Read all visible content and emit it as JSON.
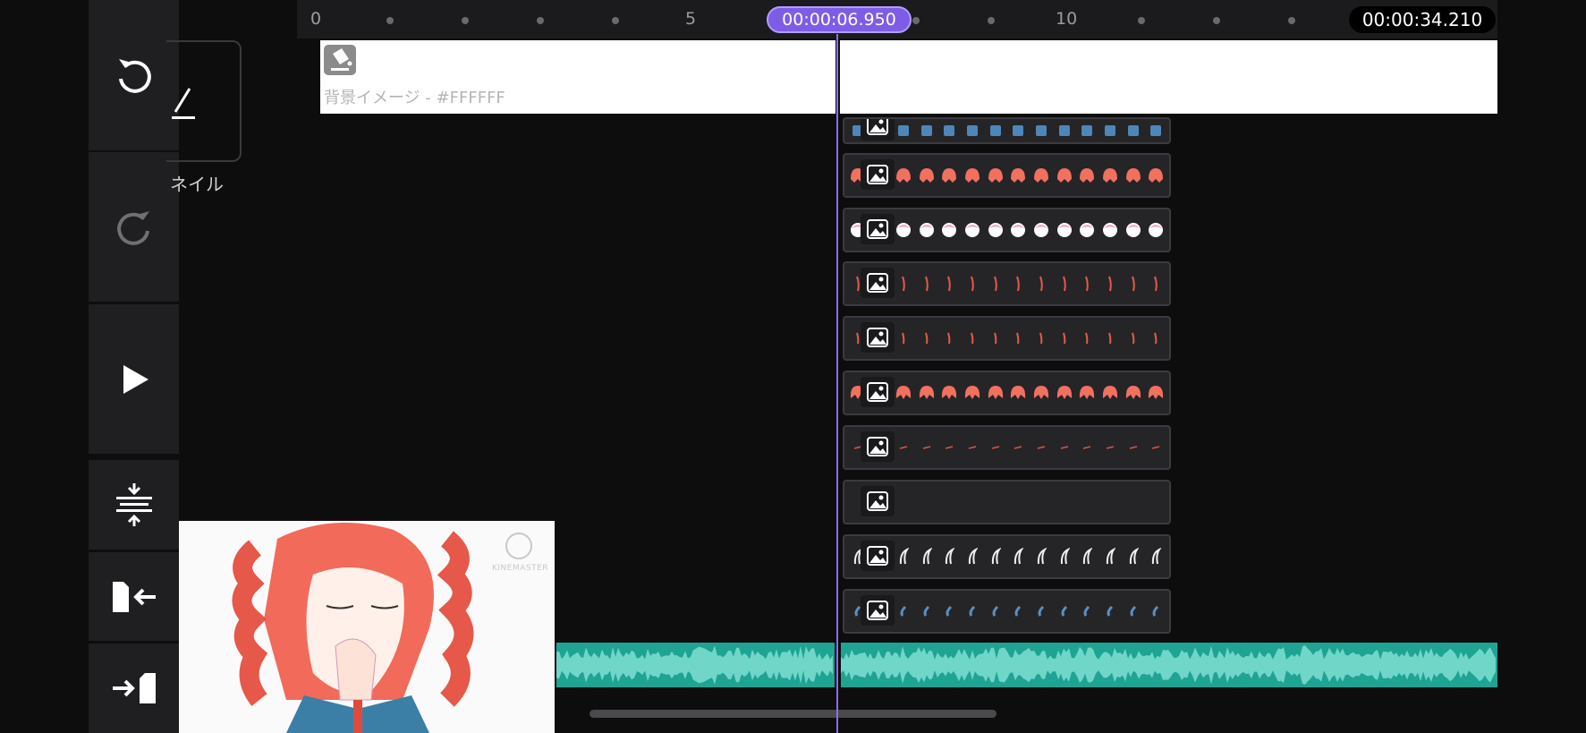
{
  "timeline": {
    "current_time": "00:00:06.950",
    "total_duration": "00:00:34.210",
    "ruler_numbers": [
      "0",
      "5",
      "10"
    ]
  },
  "background_track": {
    "label": "背景イメージ - #FFFFFF",
    "color": "#FFFFFF"
  },
  "media_browser": {
    "label": "ネイル"
  },
  "tools": [
    {
      "name": "undo",
      "icon": "undo-icon",
      "enabled": true
    },
    {
      "name": "redo",
      "icon": "redo-icon",
      "enabled": false
    },
    {
      "name": "play",
      "icon": "play-icon"
    },
    {
      "name": "fit-timeline",
      "icon": "compress-vertical-icon"
    },
    {
      "name": "jump-to-start",
      "icon": "jump-start-icon"
    },
    {
      "name": "jump-to-end",
      "icon": "jump-end-icon"
    }
  ],
  "layers": [
    {
      "type": "image",
      "icon": "image-icon",
      "thumb_color": "#4e86b8"
    },
    {
      "type": "image",
      "icon": "image-icon",
      "thumb_color": "#f2705f"
    },
    {
      "type": "image",
      "icon": "image-icon",
      "thumb_color": "#f3a6c6"
    },
    {
      "type": "image",
      "icon": "image-icon",
      "thumb_color": "#e8584a"
    },
    {
      "type": "image",
      "icon": "image-icon",
      "thumb_color": "#e8584a"
    },
    {
      "type": "image",
      "icon": "image-icon",
      "thumb_color": "#f2705f"
    },
    {
      "type": "image",
      "icon": "image-icon",
      "thumb_color": "#d9544a"
    },
    {
      "type": "image",
      "icon": "image-icon",
      "thumb_color": "#2a2a2d"
    },
    {
      "type": "image",
      "icon": "image-icon",
      "thumb_color": "#f0f0f0"
    },
    {
      "type": "image",
      "icon": "image-icon",
      "thumb_color": "#5b8fc0"
    }
  ],
  "audio_track": {
    "color": "#1fa393",
    "wave_color": "#6fd6c8"
  },
  "preview": {
    "watermark": "KINEMASTER",
    "accent_color": "#f0604f"
  },
  "colors": {
    "accent": "#7f5ce6",
    "panel": "#1f1f21",
    "background": "#0d0d0e"
  }
}
